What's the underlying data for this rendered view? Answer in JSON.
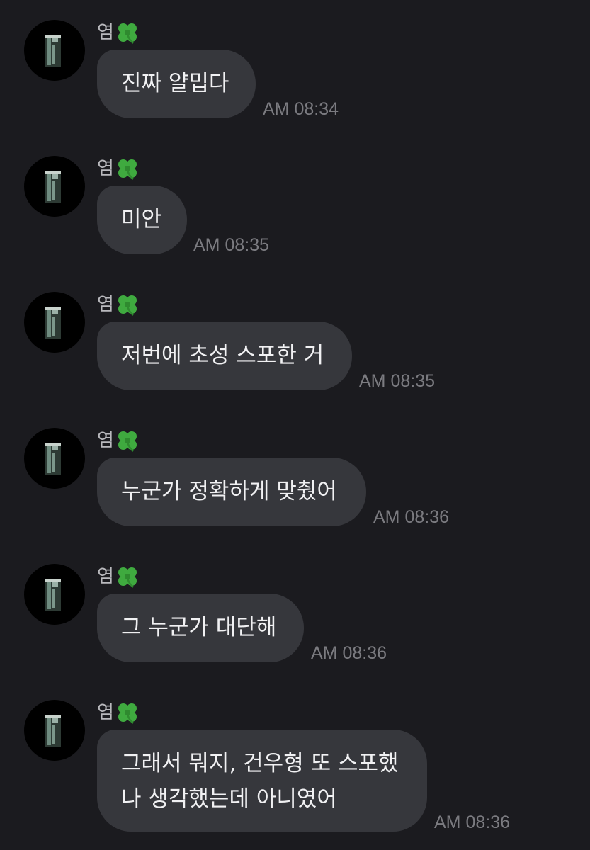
{
  "messages": [
    {
      "sender": "염",
      "lines": [
        "진짜 얄밉다"
      ],
      "time": "AM 08:34"
    },
    {
      "sender": "염",
      "lines": [
        "미안"
      ],
      "time": "AM 08:35"
    },
    {
      "sender": "염",
      "lines": [
        "저번에 초성 스포한 거"
      ],
      "time": "AM 08:35"
    },
    {
      "sender": "염",
      "lines": [
        "누군가 정확하게 맞췄어"
      ],
      "time": "AM 08:36"
    },
    {
      "sender": "염",
      "lines": [
        "그 누군가 대단해"
      ],
      "time": "AM 08:36"
    },
    {
      "sender": "염",
      "lines": [
        "그래서 뭐지, 건우형 또 스포했",
        "나 생각했는데 아니였어"
      ],
      "time": "AM 08:36"
    }
  ],
  "icons": {
    "sender_badge": "four-leaf-clover-icon",
    "avatar": "dark-window-silhouette-avatar"
  },
  "colors": {
    "background": "#1b1b1f",
    "bubble": "#36373c",
    "bubble_text": "#f1f1f3",
    "sender_text": "#b9b9bd",
    "time_text": "#7b7b80",
    "clover": "#3faa3f"
  }
}
